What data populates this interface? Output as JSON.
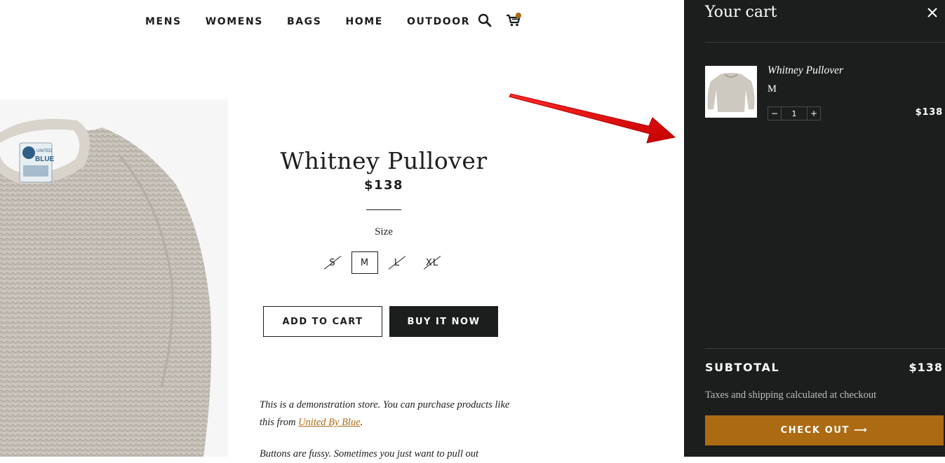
{
  "nav": {
    "items": [
      "MENS",
      "WOMENS",
      "BAGS",
      "HOME",
      "OUTDOOR"
    ],
    "search_icon": "search-icon",
    "cart_icon": "cart-icon"
  },
  "product": {
    "title": "Whitney Pullover",
    "price": "$138",
    "size_label": "Size",
    "sizes": [
      {
        "label": "S",
        "available": false
      },
      {
        "label": "M",
        "available": true,
        "selected": true
      },
      {
        "label": "L",
        "available": false
      },
      {
        "label": "XL",
        "available": false
      }
    ],
    "add_to_cart": "ADD TO CART",
    "buy_now": "BUY IT NOW",
    "description_before": "This is a demonstration store. You can purchase products like this from ",
    "description_link": "United By Blue",
    "description_after": ".",
    "description_more": "Buttons are fussy. Sometimes you just want to pull out"
  },
  "cart": {
    "title": "Your cart",
    "line_items": [
      {
        "name": "Whitney Pullover",
        "variant": "M",
        "quantity": "1",
        "price": "$138",
        "qty_minus": "−",
        "qty_plus": "+"
      }
    ],
    "subtotal_label": "SUBTOTAL",
    "subtotal_value": "$138",
    "tax_note": "Taxes and shipping calculated at checkout",
    "checkout_label": "CHECK OUT ⟶"
  },
  "colors": {
    "accent": "#ac6b13",
    "drawer_bg": "#1c1d1d",
    "text": "#1c1d1d",
    "arrow": "#e01010"
  }
}
